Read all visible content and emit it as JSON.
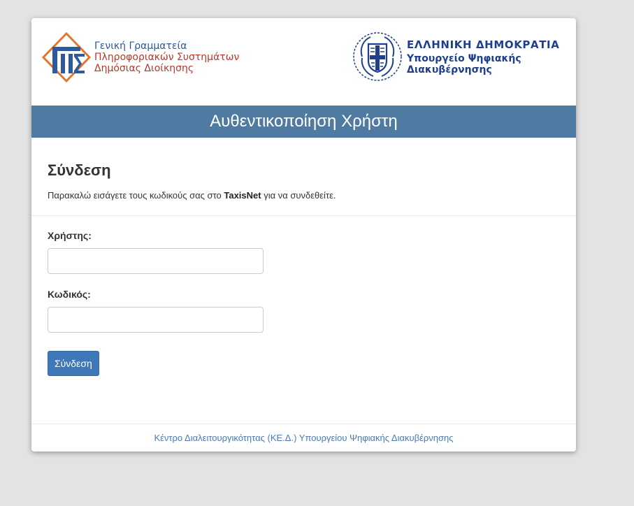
{
  "branding": {
    "gsis_line1": "Γενική Γραμματεία",
    "gsis_line2": "Πληροφοριακών Συστημάτων",
    "gsis_line3": "Δημόσιας Διοίκησης",
    "gov_title": "ΕΛΛΗΝΙΚΗ ΔΗΜΟΚΡΑΤΙΑ",
    "ministry_line1": "Υπουργείο Ψηφιακής",
    "ministry_line2": "Διακυβέρνησης"
  },
  "header": {
    "title": "Αυθεντικοποίηση Χρήστη"
  },
  "login": {
    "heading": "Σύνδεση",
    "instruction_prefix": "Παρακαλώ εισάγετε τους κωδικούς σας στο ",
    "instruction_bold": "TaxisNet",
    "instruction_suffix": " για να συνδεθείτε.",
    "username_label": "Χρήστης:",
    "username_value": "",
    "password_label": "Κωδικός:",
    "password_value": "",
    "submit_label": "Σύνδεση"
  },
  "footer": {
    "link_text": "Κέντρο Διαλειτουργικότητας (ΚΕ.Δ.) Υπουργείου Ψηφιακής Διακυβέρνησης"
  },
  "colors": {
    "header_bg": "#4f7ba3",
    "button_bg": "#3f78b8",
    "footer_link": "#4a7ab0",
    "gsis_blue": "#2c5a9c",
    "gsis_red": "#b8372a",
    "gov_blue": "#1f3f8e"
  }
}
